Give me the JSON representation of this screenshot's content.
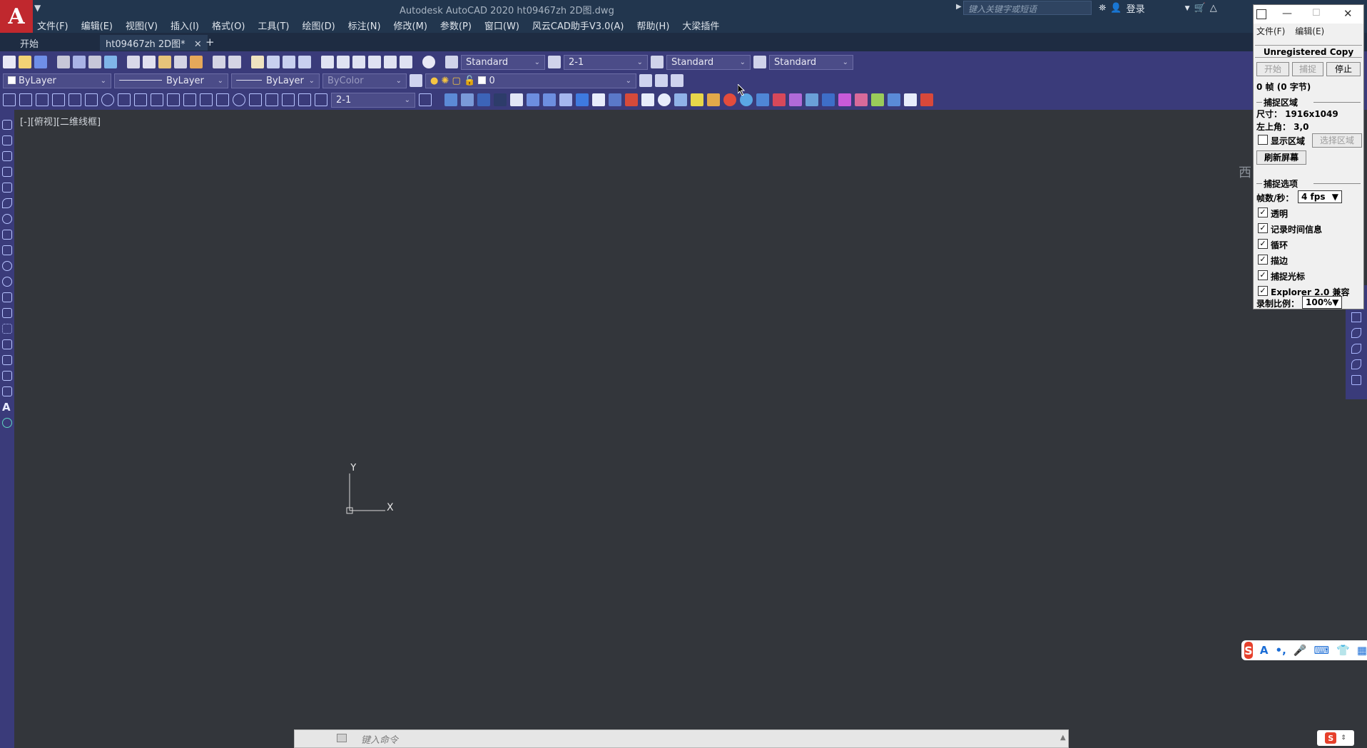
{
  "app": {
    "title": "Autodesk AutoCAD 2020    ht09467zh 2D图.dwg",
    "logo": "A"
  },
  "menu": [
    "文件(F)",
    "编辑(E)",
    "视图(V)",
    "插入(I)",
    "格式(O)",
    "工具(T)",
    "绘图(D)",
    "标注(N)",
    "修改(M)",
    "参数(P)",
    "窗口(W)",
    "风云CAD助手V3.0(A)",
    "帮助(H)",
    "大梁插件"
  ],
  "header": {
    "search_placeholder": "键入关键字或短语",
    "login_label": "登录"
  },
  "tabs": {
    "start": "开始",
    "doc": "ht09467zh 2D图*",
    "close": "✕",
    "add": "+"
  },
  "toolbar1": {
    "textstyle": "Standard",
    "dimscale": "2-1",
    "tablestyle": "Standard",
    "mleaderstyle": "Standard"
  },
  "toolbar2": {
    "color": "ByLayer",
    "linetype": "ByLayer",
    "lineweight": "ByLayer",
    "plotstyle": "ByColor",
    "layer": "0"
  },
  "toolbar3": {
    "dimstyle": "2-1"
  },
  "canvas": {
    "viewport_label": "[-][俯视][二维线框]",
    "ucs_x": "X",
    "ucs_y": "Y",
    "viewcube_label": "西"
  },
  "command": {
    "placeholder": "键入命令"
  },
  "capture_tool": {
    "menus": [
      "文件(F)",
      "编辑(E)"
    ],
    "unregistered": "Unregistered Copy",
    "btn_start": "开始",
    "btn_capture": "捕捉",
    "btn_stop": "停止",
    "frames": "0 帧 (0 字节)",
    "region_group": "捕捉区域",
    "size": "尺寸： 1916x1049",
    "corner": "左上角： 3,0",
    "show_region": "显示区域",
    "select_region": "选择区域",
    "refresh": "刷新屏幕",
    "options_group": "捕捉选项",
    "fps_label": "帧数/秒：",
    "fps_value": "4 fps",
    "options": [
      {
        "label": "透明",
        "checked": true
      },
      {
        "label": "记录时间信息",
        "checked": true
      },
      {
        "label": "循环",
        "checked": true
      },
      {
        "label": "描边",
        "checked": true
      },
      {
        "label": "捕捉光标",
        "checked": true
      },
      {
        "label": "Explorer 2.0 兼容",
        "checked": true
      }
    ],
    "scale_label": "录制比例：",
    "scale_value": "100%"
  },
  "ime": {
    "logo": "S",
    "a_label": "A"
  }
}
